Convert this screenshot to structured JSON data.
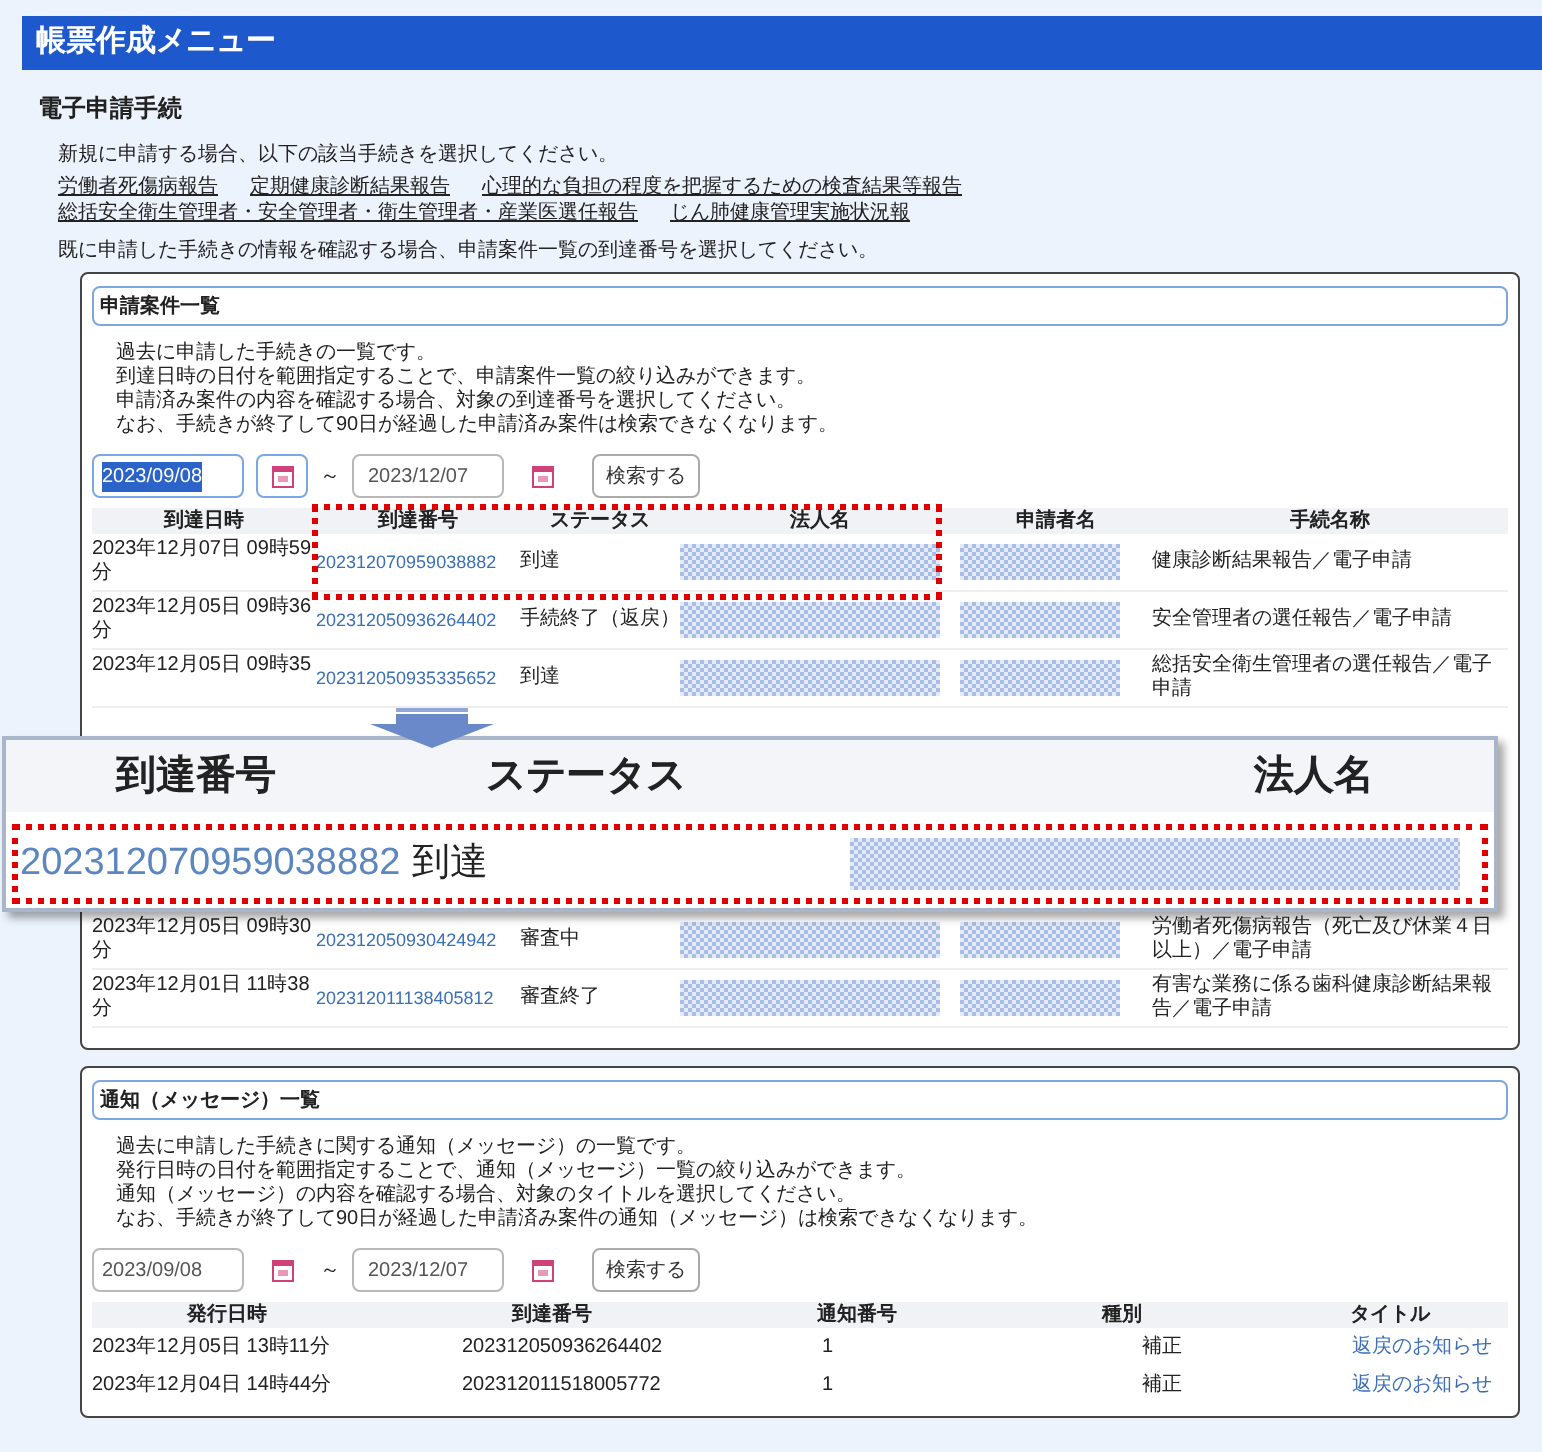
{
  "header": {
    "title": "帳票作成メニュー"
  },
  "section_title": "電子申請手続",
  "new_instruction": "新規に申請する場合、以下の該当手続きを選択してください。",
  "procedure_links": [
    "労働者死傷病報告",
    "定期健康診断結果報告",
    "心理的な負担の程度を把握するための検査結果等報告",
    "総括安全衛生管理者・安全管理者・衛生管理者・産業医選任報告",
    "じん肺健康管理実施状況報"
  ],
  "existing_instruction": "既に申請した手続きの情報を確認する場合、申請案件一覧の到達番号を選択してください。",
  "applications": {
    "title": "申請案件一覧",
    "description": [
      "過去に申請した手続きの一覧です。",
      "到達日時の日付を範囲指定することで、申請案件一覧の絞り込みができます。",
      "申請済み案件の内容を確認する場合、対象の到達番号を選択してください。",
      "なお、手続きが終了して90日が経過した申請済み案件は検索できなくなります。"
    ],
    "date_from": "2023/09/08",
    "date_from_selected": true,
    "calendar_focused": true,
    "range_sep": "～",
    "date_to": "2023/12/07",
    "search_button": "検索する",
    "columns": [
      "到達日時",
      "到達番号",
      "ステータス",
      "法人名",
      "申請者名",
      "手続名称"
    ],
    "rows_before": [
      {
        "arrival_datetime": "2023年12月07日 09時59分",
        "arrival_number": "202312070959038882",
        "status": "到達",
        "procedure": "健康診断結果報告／電子申請"
      },
      {
        "arrival_datetime": "2023年12月05日 09時36分",
        "arrival_number": "202312050936264402",
        "status": "手続終了（返戻）",
        "procedure": "安全管理者の選任報告／電子申請"
      },
      {
        "arrival_datetime": "2023年12月05日 09時35",
        "arrival_number": "202312050935335652",
        "status": "到達",
        "procedure": "総括安全衛生管理者の選任報告／電子申請"
      }
    ],
    "rows_after": [
      {
        "arrival_datetime": "2023年12月05日 09時30分",
        "arrival_number": "202312050930424942",
        "status": "審査中",
        "procedure": "労働者死傷病報告（死亡及び休業４日以上）／電子申請"
      },
      {
        "arrival_datetime": "2023年12月01日 11時38分",
        "arrival_number": "202312011138405812",
        "status": "審査終了",
        "procedure": "有害な業務に係る歯科健康診断結果報告／電子申請"
      }
    ]
  },
  "callout": {
    "columns": [
      "到達番号",
      "ステータス",
      "法人名"
    ],
    "arrival_number": "202312070959038882",
    "status": "到達"
  },
  "notices": {
    "title": "通知（メッセージ）一覧",
    "description": [
      "過去に申請した手続きに関する通知（メッセージ）の一覧です。",
      "発行日時の日付を範囲指定することで、通知（メッセージ）一覧の絞り込みができます。",
      "通知（メッセージ）の内容を確認する場合、対象のタイトルを選択してください。",
      "なお、手続きが終了して90日が経過した申請済み案件の通知（メッセージ）は検索できなくなります。"
    ],
    "date_from": "2023/09/08",
    "date_from_selected": false,
    "calendar_focused": false,
    "range_sep": "～",
    "date_to": "2023/12/07",
    "search_button": "検索する",
    "columns": [
      "発行日時",
      "到達番号",
      "通知番号",
      "種別",
      "タイトル"
    ],
    "rows": [
      {
        "issued": "2023年12月05日 13時11分",
        "arrival_number": "202312050936264402",
        "notice_number": "1",
        "type": "補正",
        "title": "返戻のお知らせ"
      },
      {
        "issued": "2023年12月04日 14時44分",
        "arrival_number": "202312011518005772",
        "notice_number": "1",
        "type": "補正",
        "title": "返戻のお知らせ"
      }
    ]
  }
}
